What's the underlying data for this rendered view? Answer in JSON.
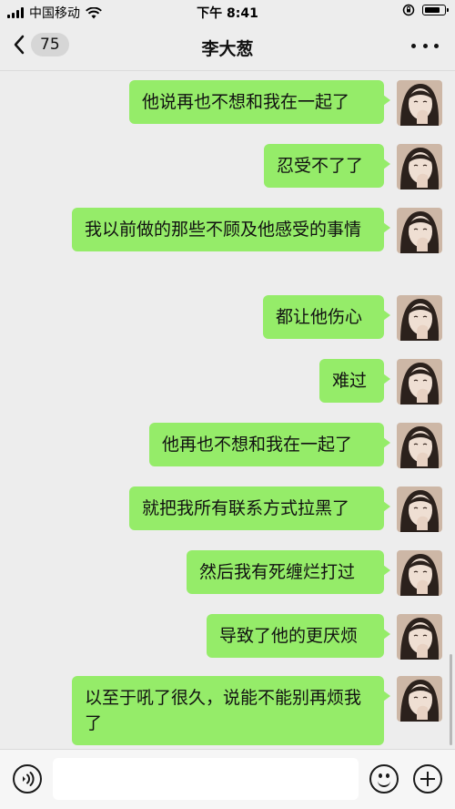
{
  "status_bar": {
    "carrier": "中国移动",
    "time": "下午 8:41"
  },
  "nav": {
    "unread_count": "75",
    "title": "李大葱"
  },
  "messages": [
    {
      "text": "他说再也不想和我在一起了"
    },
    {
      "text": "忍受不了了"
    },
    {
      "text": "我以前做的那些不顾及他感受的事情"
    },
    {
      "text": "都让他伤心"
    },
    {
      "text": "难过"
    },
    {
      "text": "他再也不想和我在一起了"
    },
    {
      "text": "就把我所有联系方式拉黑了"
    },
    {
      "text": "然后我有死缠烂打过"
    },
    {
      "text": "导致了他的更厌烦"
    },
    {
      "text": "以至于吼了很久，说能不能别再烦我了"
    }
  ],
  "input": {
    "placeholder": ""
  },
  "colors": {
    "bubble": "#95ec69",
    "background": "#ededed"
  }
}
